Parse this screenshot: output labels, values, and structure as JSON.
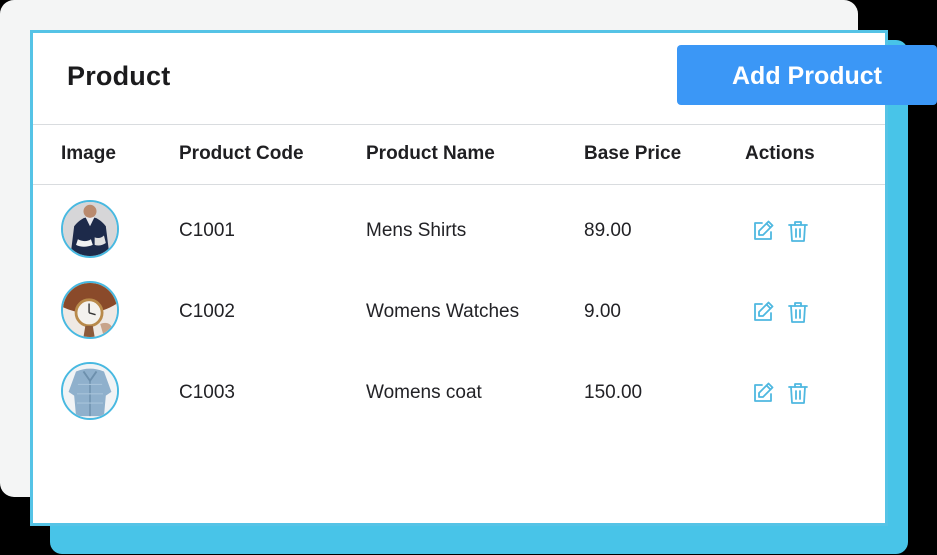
{
  "card": {
    "title": "Product",
    "add_button_label": "Add Product"
  },
  "table": {
    "columns": [
      "Image",
      "Product Code",
      "Product Name",
      "Base Price",
      "Actions"
    ],
    "rows": [
      {
        "image": "mens-shirt-photo",
        "code": "C1001",
        "name": "Mens Shirts",
        "price": "89.00"
      },
      {
        "image": "womens-watch-photo",
        "code": "C1002",
        "name": "Womens Watches",
        "price": "9.00"
      },
      {
        "image": "womens-coat-photo",
        "code": "C1003",
        "name": "Womens coat",
        "price": "150.00"
      }
    ]
  },
  "icons": {
    "edit": "edit-icon",
    "delete": "trash-icon"
  },
  "colors": {
    "accent": "#3b97f6",
    "card_border": "#55c3e6",
    "shadow_panel": "#48c4e8",
    "icon": "#4fb8e0"
  }
}
